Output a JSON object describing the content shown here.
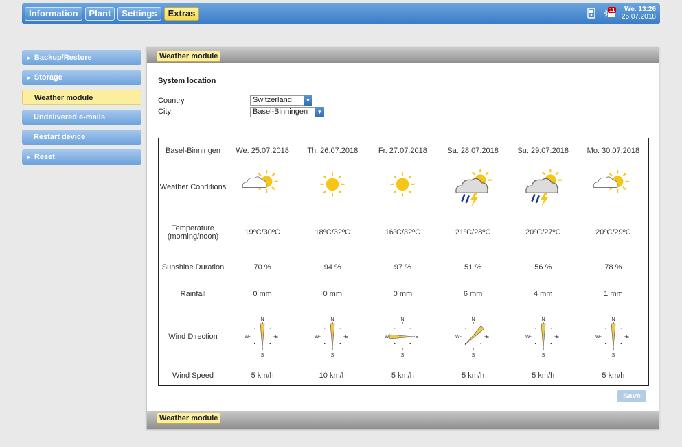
{
  "nav": {
    "items": [
      "Information",
      "Plant",
      "Settings",
      "Extras"
    ],
    "active": 3
  },
  "status": {
    "day_time": "We. 13:26",
    "date": "25.07.2018",
    "event_count": "11"
  },
  "sidebar": {
    "items": [
      "Backup/Restore",
      "Storage",
      "Weather module",
      "Undelivered e-mails",
      "Restart device",
      "Reset"
    ],
    "active": 2
  },
  "panel": {
    "header_title": "Weather module",
    "footer_title": "Weather module",
    "section_title": "System location",
    "country_label": "Country",
    "country_value": "Switzerland",
    "city_label": "City",
    "city_value": "Basel-Binningen",
    "save_label": "Save"
  },
  "forecast": {
    "location": "Basel-Binningen",
    "row_labels": {
      "conditions": "Weather Conditions",
      "temperature": "Temperature",
      "temperature_sub": "(morning/noon)",
      "sunshine": "Sunshine Duration",
      "rainfall": "Rainfall",
      "wind_direction": "Wind Direction",
      "wind_speed": "Wind Speed"
    },
    "compass": {
      "n": "N",
      "e": "-E",
      "s": "S",
      "w": "W-"
    },
    "days": [
      {
        "date": "We. 25.07.2018",
        "icon": "partly-cloudy-sun-icon",
        "temp": "19ºC/30ºC",
        "sunshine": "70 %",
        "rain": "0 mm",
        "wind_deg": 180,
        "wind": "5 km/h"
      },
      {
        "date": "Th. 26.07.2018",
        "icon": "sun-icon",
        "temp": "18ºC/32ºC",
        "sunshine": "94 %",
        "rain": "0 mm",
        "wind_deg": 180,
        "wind": "10 km/h"
      },
      {
        "date": "Fr. 27.07.2018",
        "icon": "sun-icon",
        "temp": "16ºC/32ºC",
        "sunshine": "97 %",
        "rain": "0 mm",
        "wind_deg": 90,
        "wind": "5 km/h"
      },
      {
        "date": "Sa. 28.07.2018",
        "icon": "thunderstorm-rain-icon",
        "temp": "21ºC/28ºC",
        "sunshine": "51 %",
        "rain": "6 mm",
        "wind_deg": 225,
        "wind": "5 km/h"
      },
      {
        "date": "Su. 29.07.2018",
        "icon": "thunderstorm-rain-icon",
        "temp": "20ºC/27ºC",
        "sunshine": "56 %",
        "rain": "4 mm",
        "wind_deg": 180,
        "wind": "5 km/h"
      },
      {
        "date": "Mo. 30.07.2018",
        "icon": "partly-cloudy-sun-icon",
        "temp": "20ºC/29ºC",
        "sunshine": "78 %",
        "rain": "1 mm",
        "wind_deg": 180,
        "wind": "5 km/h"
      }
    ]
  },
  "colors": {
    "accent_blue": "#3a7cc6",
    "active_yellow": "#fbef9f",
    "sun": "#f5c518"
  }
}
